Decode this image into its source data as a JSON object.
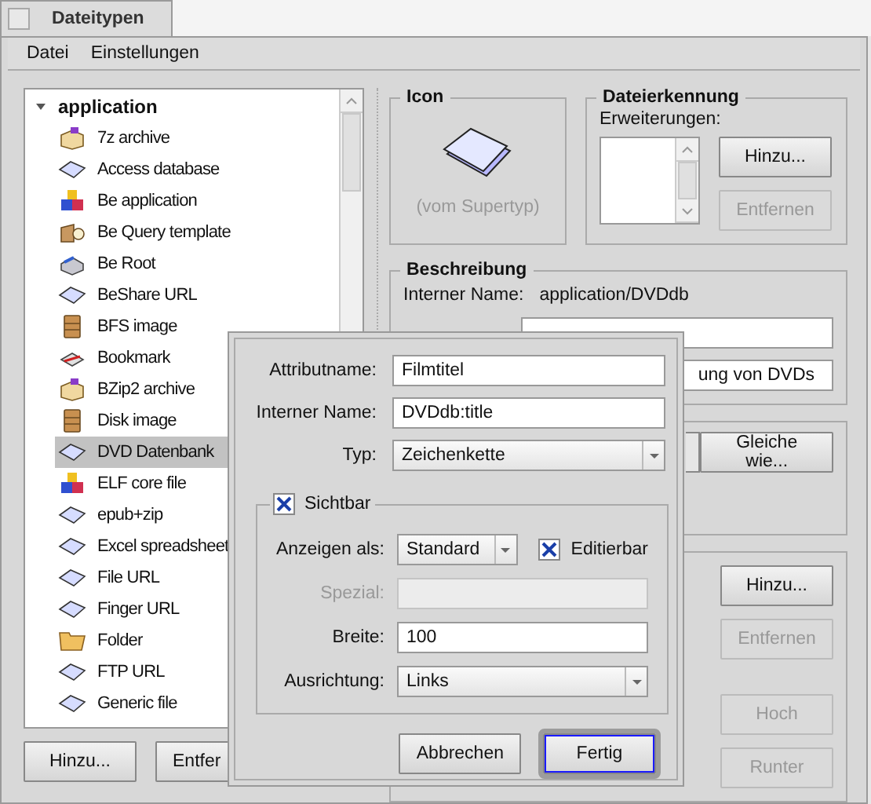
{
  "window": {
    "tab": "Dateitypen"
  },
  "menu": [
    "Datei",
    "Einstellungen"
  ],
  "tree": {
    "label": "application",
    "expanded": true,
    "children": [
      {
        "label": "7z archive",
        "kind": "archive",
        "selected": false
      },
      {
        "label": "Access database",
        "kind": "document",
        "selected": false
      },
      {
        "label": "Be application",
        "kind": "app",
        "selected": false
      },
      {
        "label": "Be Query template",
        "kind": "query",
        "selected": false
      },
      {
        "label": "Be Root",
        "kind": "root",
        "selected": false
      },
      {
        "label": "BeShare URL",
        "kind": "document",
        "selected": false
      },
      {
        "label": "BFS image",
        "kind": "disk",
        "selected": false
      },
      {
        "label": "Bookmark",
        "kind": "bookmark",
        "selected": false
      },
      {
        "label": "BZip2 archive",
        "kind": "archive",
        "selected": false
      },
      {
        "label": "Disk image",
        "kind": "disk",
        "selected": false
      },
      {
        "label": "DVD Datenbank",
        "kind": "document",
        "selected": true
      },
      {
        "label": "ELF core file",
        "kind": "app",
        "selected": false
      },
      {
        "label": "epub+zip",
        "kind": "document",
        "selected": false
      },
      {
        "label": "Excel spreadsheet",
        "kind": "document",
        "selected": false
      },
      {
        "label": "File URL",
        "kind": "document",
        "selected": false
      },
      {
        "label": "Finger URL",
        "kind": "document",
        "selected": false
      },
      {
        "label": "Folder",
        "kind": "folder",
        "selected": false
      },
      {
        "label": "FTP URL",
        "kind": "document",
        "selected": false
      },
      {
        "label": "Generic file",
        "kind": "document",
        "selected": false
      }
    ]
  },
  "left_buttons": [
    "Hinzu...",
    "Entfer"
  ],
  "icon_group": {
    "title": "Icon",
    "caption": "(vom Supertyp)"
  },
  "file_recognition": {
    "title": "Dateierkennung",
    "label": "Erweiterungen:",
    "buttons": [
      {
        "label": "Hinzu...",
        "disabled": false
      },
      {
        "label": "Entfernen",
        "disabled": true
      }
    ]
  },
  "description": {
    "title": "Beschreibung",
    "internal_name_label": "Interner Name:",
    "internal_name": "application/DVDdb",
    "field_value": "ung von DVDs"
  },
  "group_3": {
    "buttons": [
      {
        "label": "Gleiche wie...",
        "disabled": false
      }
    ]
  },
  "group_4": {
    "buttons": [
      {
        "label": "Hinzu...",
        "disabled": false
      },
      {
        "label": "Entfernen",
        "disabled": true
      },
      {
        "label": "Hoch",
        "disabled": true
      },
      {
        "label": "Runter",
        "disabled": true
      }
    ]
  },
  "dialog": {
    "fields": [
      {
        "kind": "text",
        "label": "Attributname:",
        "value": "Filmtitel"
      },
      {
        "kind": "text",
        "label": "Interner Name:",
        "value": "DVDdb:title"
      },
      {
        "kind": "select",
        "label": "Typ:",
        "value": "Zeichenkette"
      }
    ],
    "visible": {
      "label": "Sichtbar",
      "checked": true
    },
    "display_as": {
      "label": "Anzeigen als:",
      "value": "Standard"
    },
    "editable": {
      "label": "Editierbar",
      "checked": true
    },
    "special": {
      "label": "Spezial:",
      "disabled": true
    },
    "width": {
      "label": "Breite:",
      "value": "100"
    },
    "alignment": {
      "label": "Ausrichtung:",
      "value": "Links"
    },
    "buttons": [
      {
        "label": "Abbrechen",
        "default": false
      },
      {
        "label": "Fertig",
        "default": true
      }
    ]
  }
}
